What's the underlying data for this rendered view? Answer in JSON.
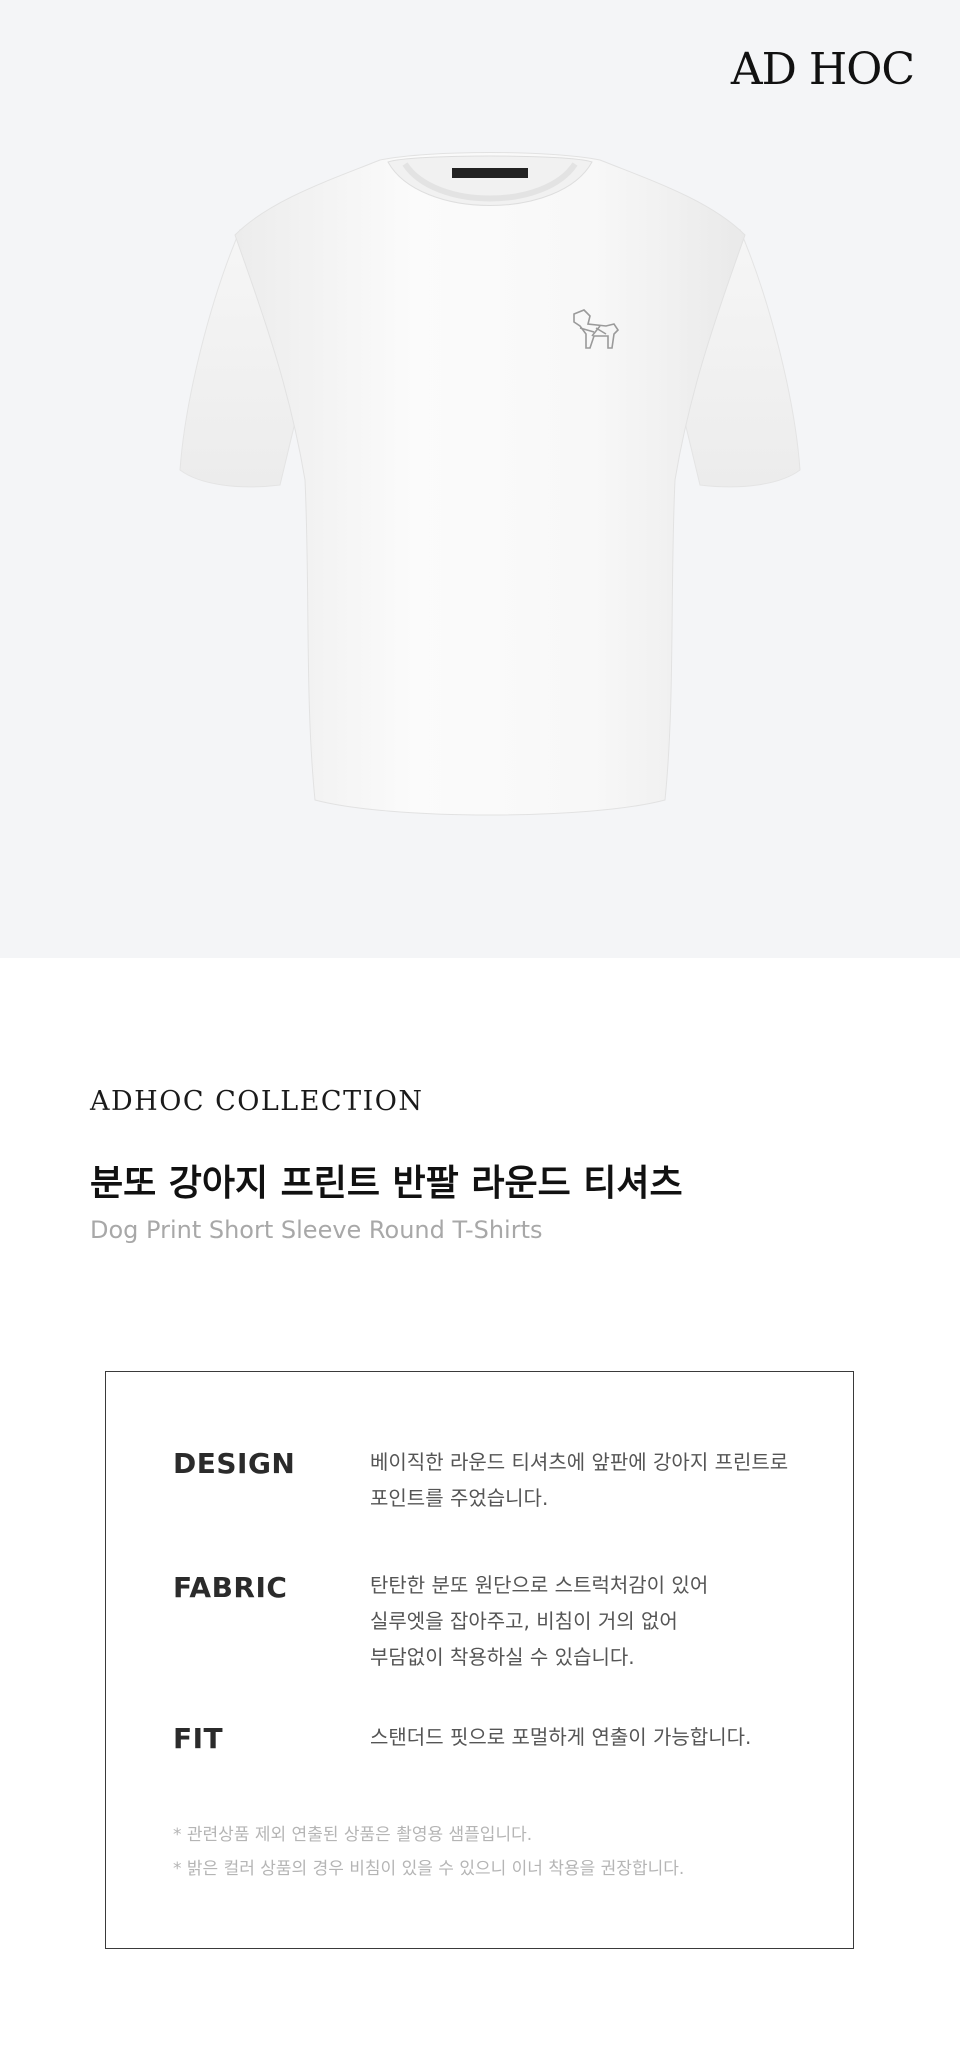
{
  "brand": {
    "logo_text": "AD HOC"
  },
  "hero": {
    "image_alt": "white short sleeve round t-shirt with dog print"
  },
  "product": {
    "collection": "ADHOC COLLECTION",
    "title_ko": "분또 강아지 프린트 반팔 라운드 티셔츠",
    "title_en": "Dog Print Short Sleeve Round T-Shirts"
  },
  "specs": [
    {
      "label": "DESIGN",
      "text": "베이직한 라운드 티셔츠에 앞판에 강아지 프린트로\n포인트를 주었습니다."
    },
    {
      "label": "FABRIC",
      "text": "탄탄한 분또 원단으로 스트럭처감이 있어\n실루엣을 잡아주고, 비침이 거의 없어\n부담없이 착용하실 수 있습니다."
    },
    {
      "label": "FIT",
      "text": "스탠더드 핏으로 포멀하게 연출이 가능합니다."
    }
  ],
  "notes": [
    "* 관련상품 제외 연출된 상품은 촬영용 샘플입니다.",
    "* 밝은 컬러 상품의 경우 비침이 있을 수 있으니 이너 착용을 권장합니다."
  ]
}
